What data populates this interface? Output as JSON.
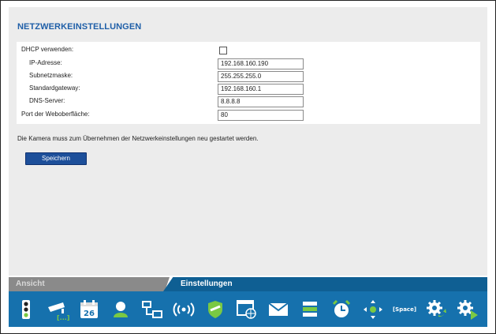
{
  "page": {
    "title": "NETZWERKEINSTELLUNGEN",
    "fields": [
      {
        "label": "DHCP verwenden:",
        "type": "checkbox",
        "checked": false
      },
      {
        "label": "IP-Adresse:",
        "type": "text",
        "value": "192.168.160.190"
      },
      {
        "label": "Subnetzmaske:",
        "type": "text",
        "value": "255.255.255.0"
      },
      {
        "label": "Standardgateway:",
        "type": "text",
        "value": "192.168.160.1"
      },
      {
        "label": "DNS-Server:",
        "type": "text",
        "value": "8.8.8.8"
      },
      {
        "label": "Port der Weboberfläche:",
        "type": "text",
        "value": "80"
      }
    ],
    "note": "Die Kamera muss zum Übernehmen der Netzwerkeinstellungen neu gestartet werden.",
    "save_label": "Speichern"
  },
  "tabs": [
    {
      "label": "Ansicht",
      "active": false
    },
    {
      "label": "Einstellungen",
      "active": true
    }
  ],
  "toolbar": {
    "calendar_day": "26",
    "space_label": "[Space]",
    "icons": [
      "traffic-light-icon",
      "camera-icon",
      "calendar-icon",
      "user-icon",
      "network-icon",
      "wireless-icon",
      "shield-icon",
      "web-icon",
      "mail-icon",
      "storage-icon",
      "alarm-clock-icon",
      "ptz-icon",
      "space-icon",
      "gear-arrow-icon",
      "gear-play-icon"
    ]
  },
  "colors": {
    "title": "#1f5fa8",
    "toolbar_bg": "#1671ad",
    "active_tab": "#0f5f93",
    "inactive_tab": "#8a8a8a",
    "save_button": "#1d4f9a",
    "icon_green": "#7ac943"
  }
}
